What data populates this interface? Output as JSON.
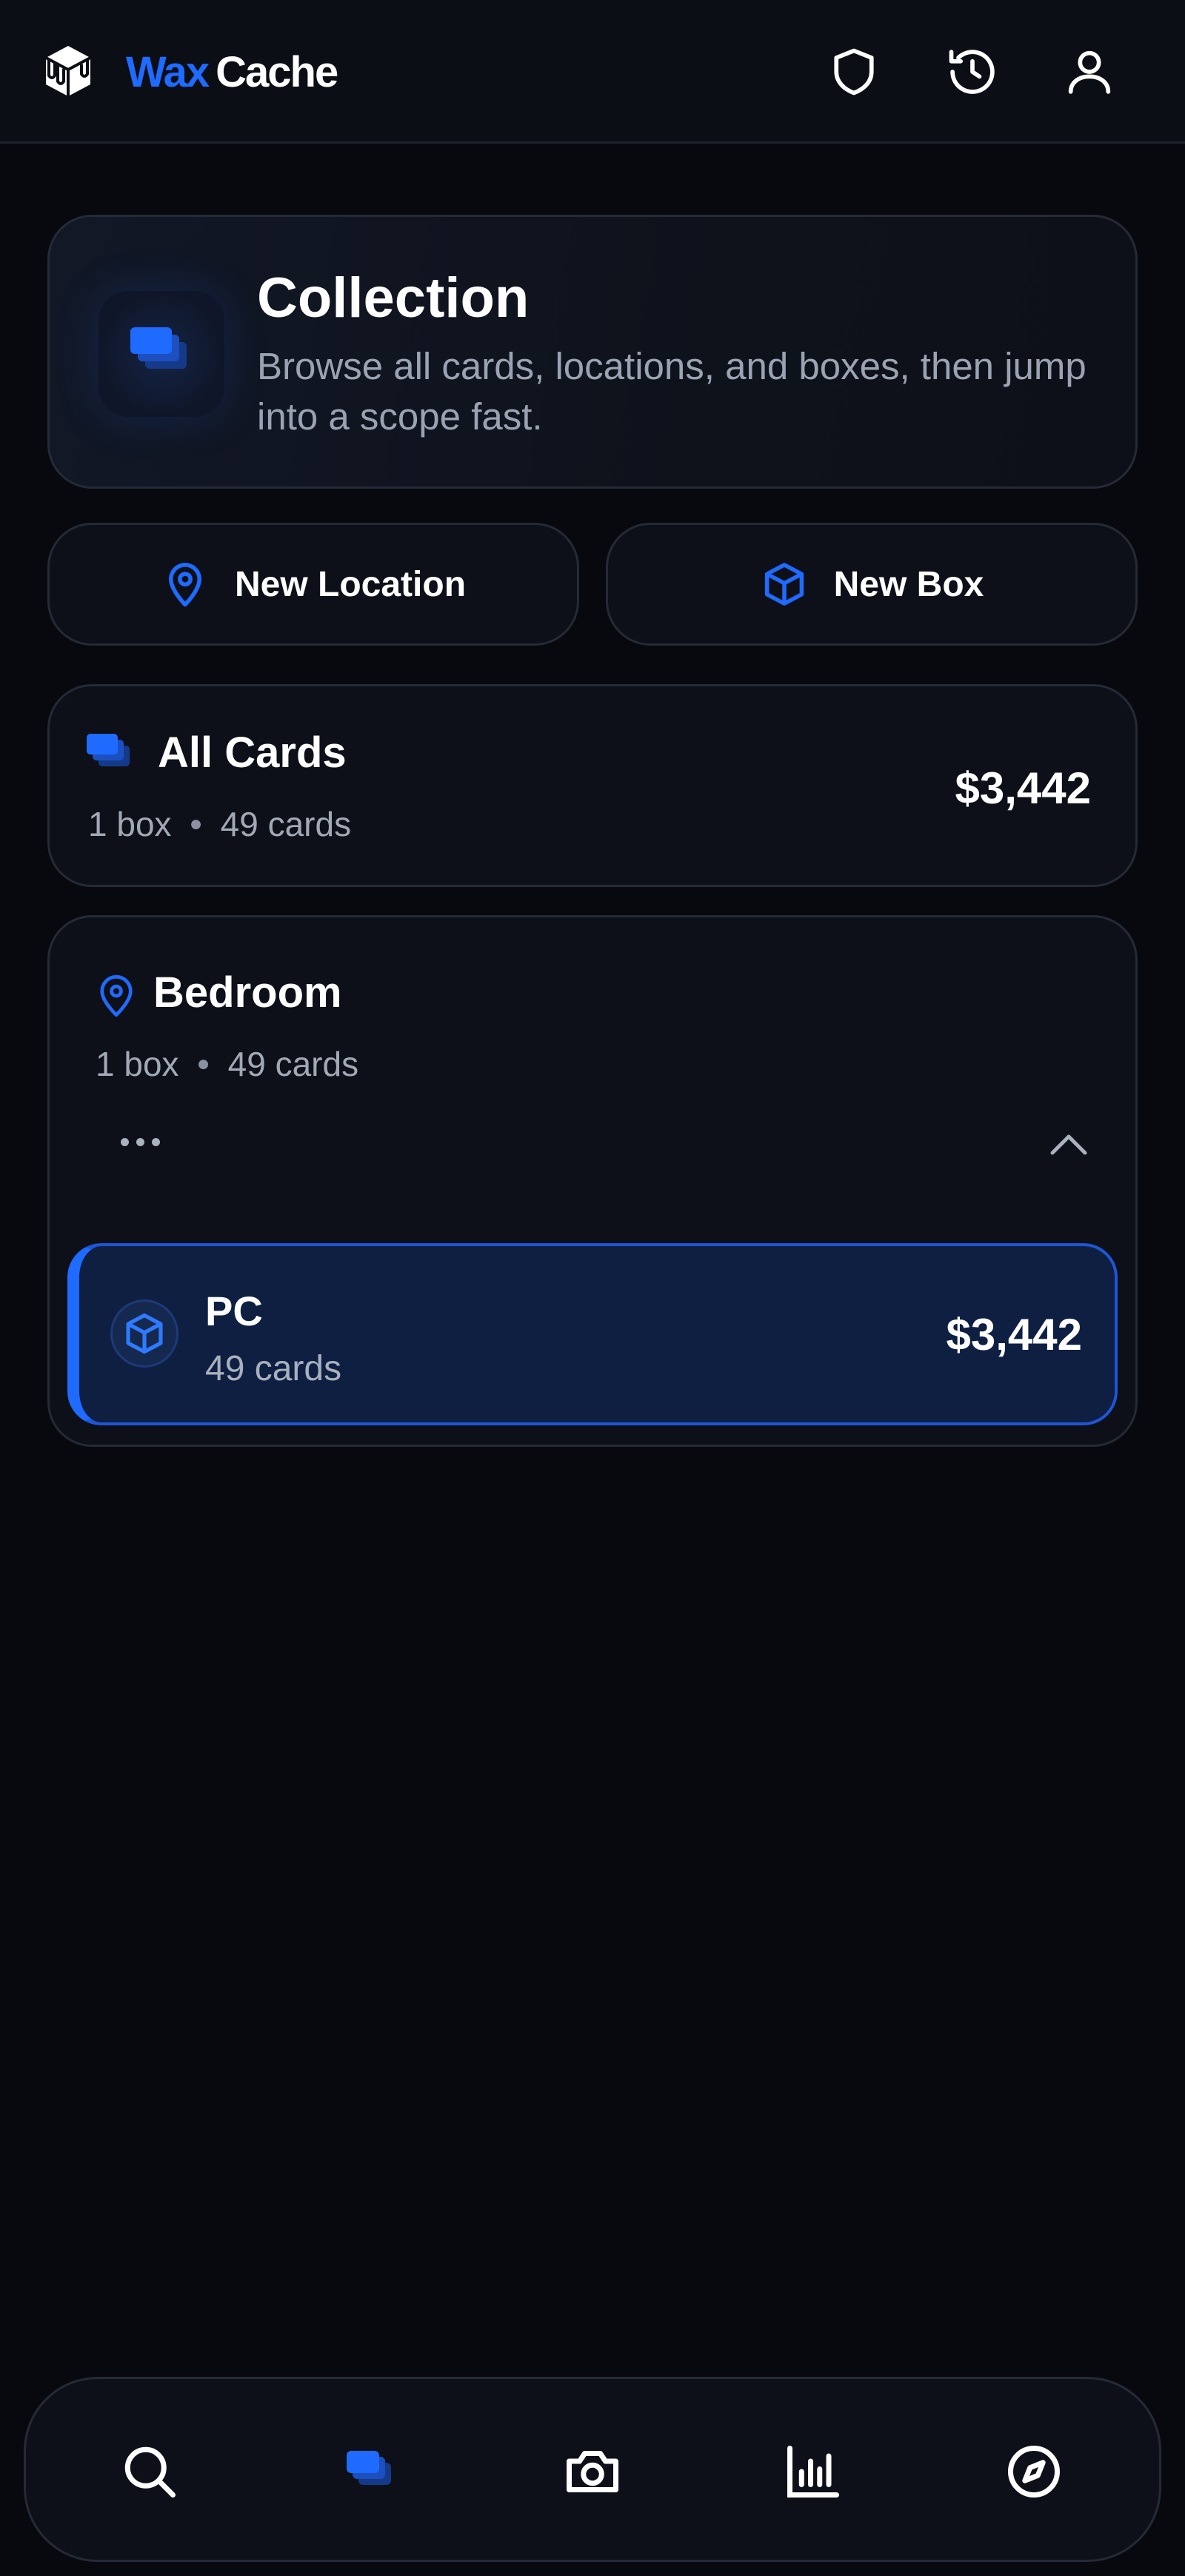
{
  "brand": {
    "word1": "Wax",
    "word2": "Cache",
    "accent": "#1f6bff"
  },
  "header": {
    "icons": [
      "shield-icon",
      "history-icon",
      "user-icon"
    ]
  },
  "hero": {
    "title": "Collection",
    "subtitle": "Browse all cards, locations, and boxes, then jump into a scope fast."
  },
  "actions": {
    "new_location": "New Location",
    "new_box": "New Box"
  },
  "all_cards": {
    "title": "All Cards",
    "boxes": "1 box",
    "cards": "49 cards",
    "value": "$3,442"
  },
  "location": {
    "name": "Bedroom",
    "boxes": "1 box",
    "cards": "49 cards",
    "box": {
      "name": "PC",
      "cards": "49 cards",
      "value": "$3,442"
    }
  },
  "bottom_nav": {
    "items": [
      "search-icon",
      "collection-icon",
      "camera-icon",
      "chart-icon",
      "compass-icon"
    ],
    "active": "collection-icon"
  },
  "colors": {
    "background": "#07090e",
    "surface": "#0d1018",
    "border": "#242a36",
    "muted_text": "#9ba3b3"
  }
}
